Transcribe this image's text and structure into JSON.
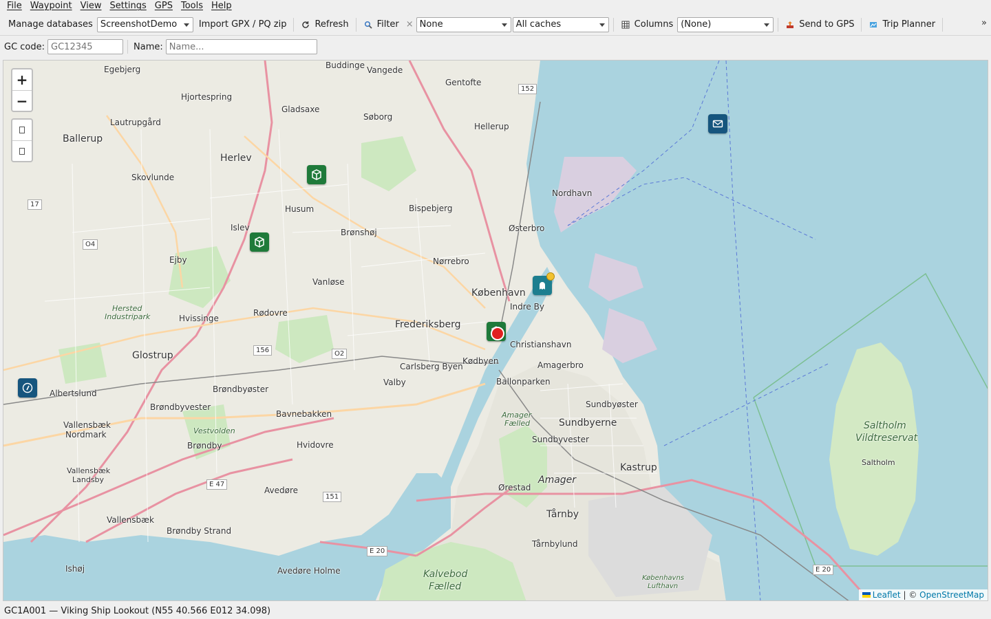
{
  "menubar": [
    "File",
    "Waypoint",
    "View",
    "Settings",
    "GPS",
    "Tools",
    "Help"
  ],
  "toolbar": {
    "manage_label": "Manage databases",
    "database_value": "ScreenshotDemo",
    "import_label": "Import GPX / PQ zip",
    "refresh_label": "Refresh",
    "filter_label": "Filter",
    "filter_clear_glyph": "×",
    "filter_value": "None",
    "caches_value": "All caches",
    "columns_label": "Columns",
    "columns_value": "(None)",
    "send_label": "Send to GPS",
    "trip_label": "Trip Planner",
    "overflow_glyph": "»"
  },
  "search": {
    "gc_label": "GC code:",
    "gc_placeholder": "GC12345",
    "name_label": "Name:",
    "name_placeholder": "Name..."
  },
  "map": {
    "zoom_in": "+",
    "zoom_out": "−",
    "place_labels": {
      "kobenhavn": "København",
      "indre_by": "Indre By",
      "frederiksberg": "Frederiksberg",
      "christianshavn": "Christianshavn",
      "amagerbro": "Amagerbro",
      "kodbyen": "Kødbyen",
      "carlsberg": "Carlsberg Byen",
      "valby": "Valby",
      "ballonparken": "Ballonparken",
      "nordhavn": "Nordhavn",
      "osterbro": "Østerbro",
      "norrebro": "Nørrebro",
      "bispebjerg": "Bispebjerg",
      "bronshoj": "Brønshøj",
      "vanlose": "Vanløse",
      "rodovre": "Rødovre",
      "hvissinge": "Hvissinge",
      "glostrup": "Glostrup",
      "albertslund": "Albertslund",
      "brondbyoster": "Brøndbyøster",
      "brondbyvester": "Brøndbyvester",
      "bavnebakken": "Bavnebakken",
      "hvidovre": "Hvidovre",
      "brondby": "Brøndby",
      "avedore": "Avedøre",
      "brondby_strand": "Brøndby Strand",
      "avedore_holme": "Avedøre Holme",
      "vallensbaek": "Vallensbæk",
      "vallensbaek_nordmark1": "Vallensbæk",
      "vallensbaek_nordmark2": "Nordmark",
      "vallensbaek_landsby1": "Vallensbæk",
      "vallensbaek_landsby2": "Landsby",
      "ishoj": "Ishøj",
      "herlev": "Herlev",
      "husum": "Husum",
      "islev": "Islev",
      "ejby": "Ejby",
      "skovlunde": "Skovlunde",
      "ballerup": "Ballerup",
      "lautrupgard": "Lautrupgård",
      "hjortespring": "Hjortespring",
      "egebjerg": "Egebjerg",
      "buddinge": "Buddinge",
      "vangede": "Vangede",
      "gladsaxe": "Gladsaxe",
      "soborg": "Søborg",
      "gentofte": "Gentofte",
      "hellerup": "Hellerup",
      "sundbyoster": "Sundbyøster",
      "sundbyerne": "Sundbyerne",
      "sundbyvester": "Sundbyvester",
      "amager": "Amager",
      "orestad": "Ørestad",
      "tarnby": "Tårnby",
      "tarnbylund": "Tårnbylund",
      "kastrup": "Kastrup",
      "saltholm": "Saltholm",
      "saltholm_res1": "Saltholm",
      "saltholm_res2": "Vildtreservat",
      "kalvebod1": "Kalvebod",
      "kalvebod2": "Fælled",
      "amager_faelled1": "Amager",
      "amager_faelled2": "Fælled",
      "vestvolden": "Vestvolden",
      "herstedindustri1": "Hersted",
      "herstedindustri2": "Industripark",
      "lufthavn1": "Københavns",
      "lufthavn2": "Lufthavn"
    },
    "road_numbers": {
      "r152": "152",
      "r17": "17",
      "r04": "O4",
      "r156": "156",
      "r02": "O2",
      "e47": "E 47",
      "r151": "151",
      "e20a": "E 20",
      "e20b": "E 20"
    },
    "attribution": {
      "leaflet": "Leaflet",
      "separator": "| ©",
      "osm": "OpenStreetMap"
    }
  },
  "status": {
    "text": "GC1A001 — Viking Ship Lookout (N55 40.566  E012 34.098)"
  },
  "colors": {
    "sea": "#aad3df",
    "land": "#ecebe3",
    "marker_green": "#1f7a3a",
    "marker_blue": "#16557e",
    "marker_teal": "#1d7e8f",
    "selected_dot": "#e02020"
  }
}
